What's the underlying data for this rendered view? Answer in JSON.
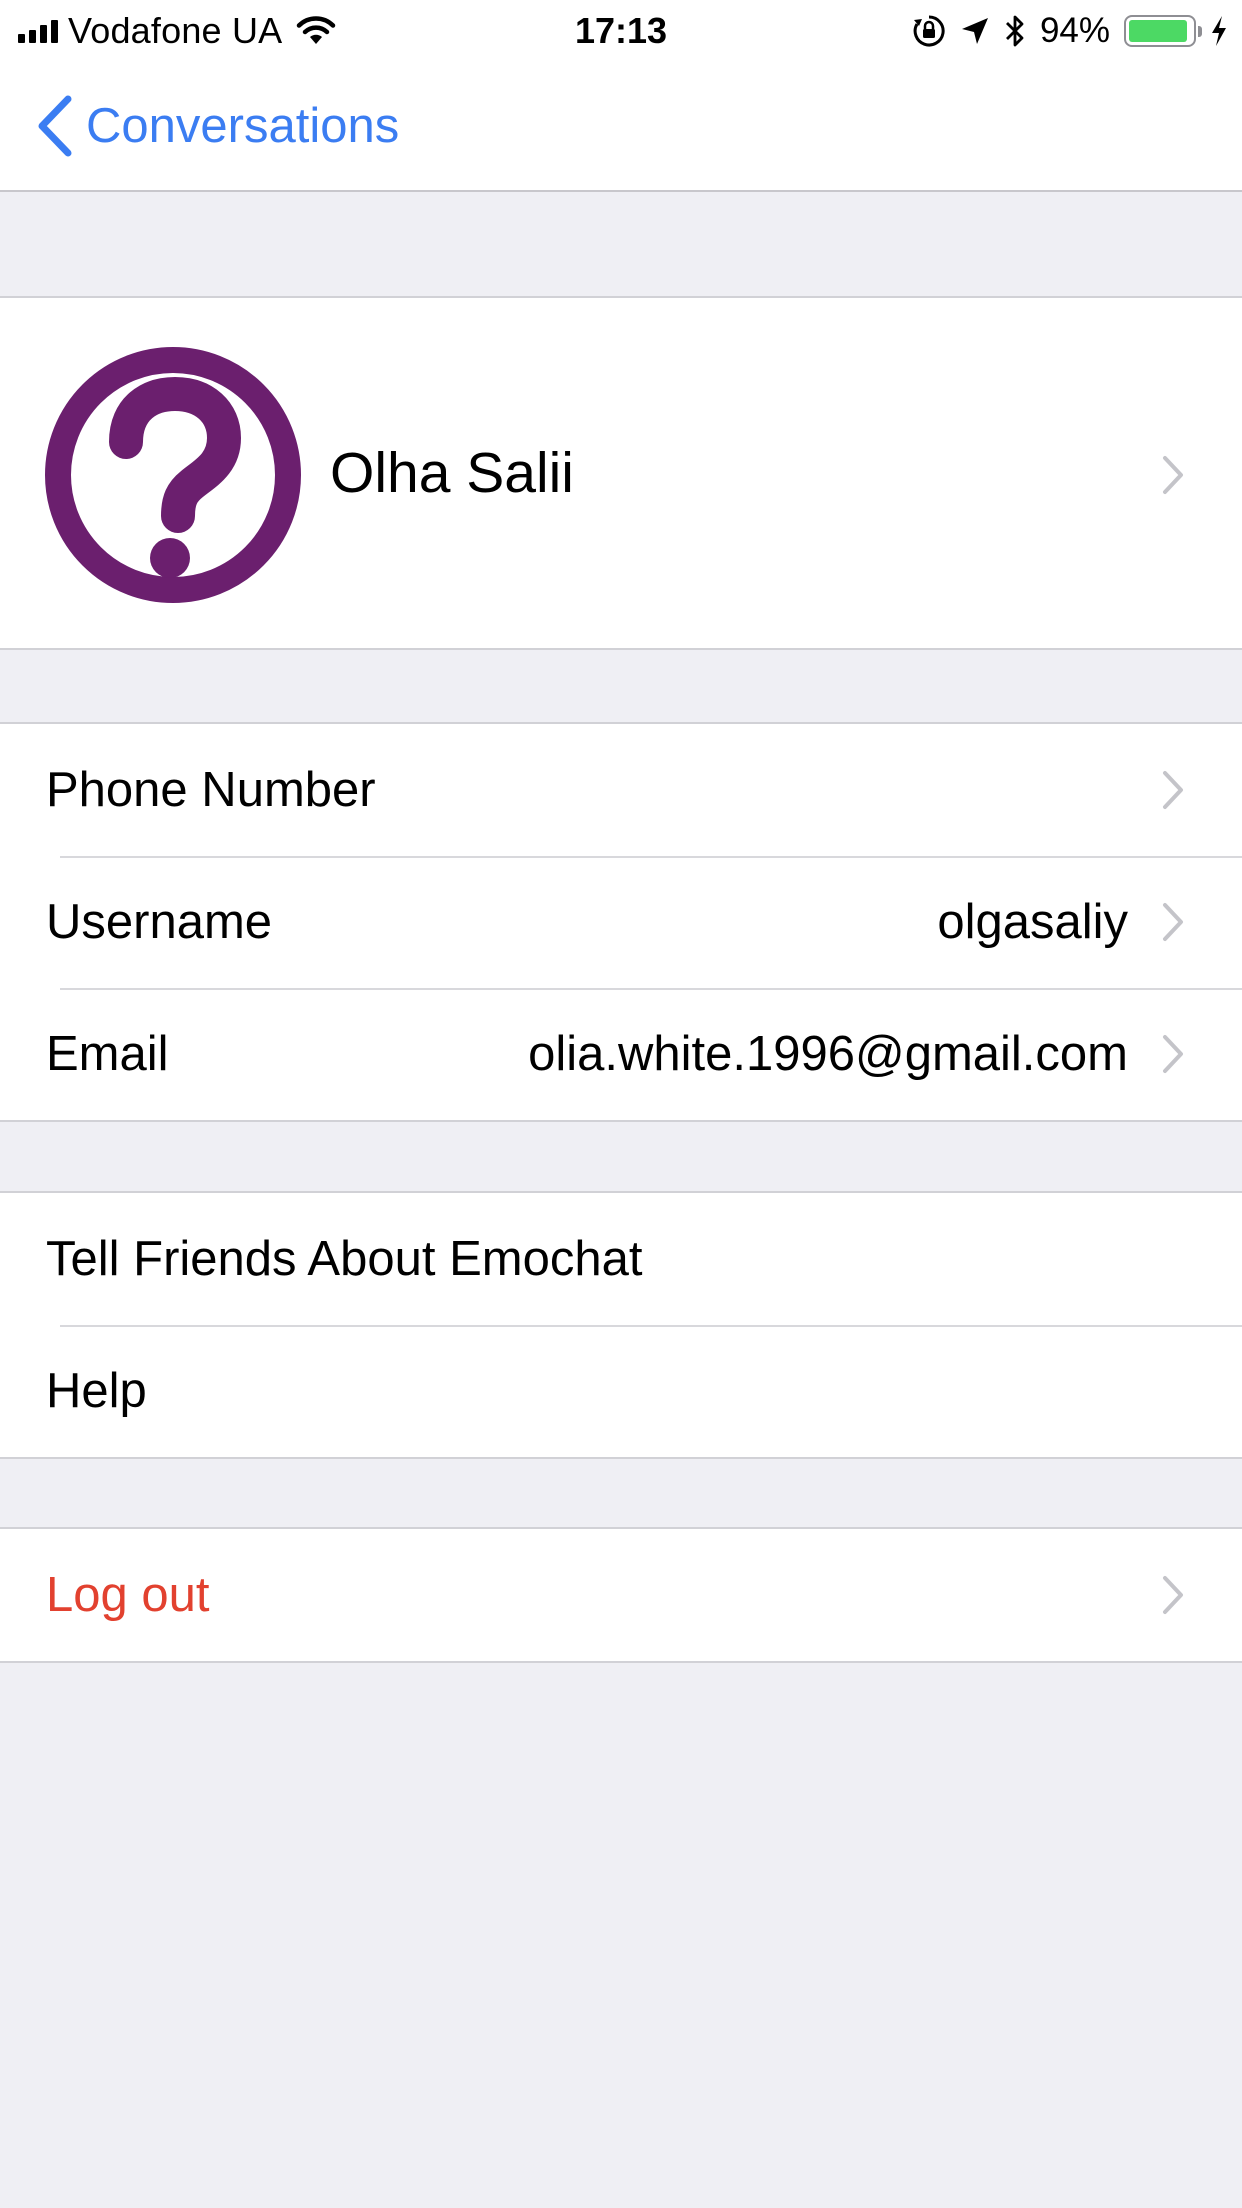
{
  "status_bar": {
    "carrier": "Vodafone UA",
    "time": "17:13",
    "battery_percent": "94%",
    "battery_level": 0.94,
    "icons": [
      "signal-icon",
      "wifi-icon",
      "orientation-lock-icon",
      "location-icon",
      "bluetooth-icon",
      "battery-icon",
      "charging-icon"
    ]
  },
  "nav": {
    "back_label": "Conversations"
  },
  "profile": {
    "name": "Olha Salii",
    "avatar_icon": "question-mark-avatar-icon",
    "avatar_color": "#6b1f6e"
  },
  "account_rows": [
    {
      "label": "Phone Number",
      "value": ""
    },
    {
      "label": "Username",
      "value": "olgasaliy"
    },
    {
      "label": "Email",
      "value": "olia.white.1996@gmail.com"
    }
  ],
  "info_rows": [
    {
      "label": "Tell Friends About Emochat"
    },
    {
      "label": "Help"
    }
  ],
  "logout": {
    "label": "Log out",
    "color": "#e2412f"
  },
  "colors": {
    "accent": "#3b7df2",
    "background": "#efeff4"
  }
}
